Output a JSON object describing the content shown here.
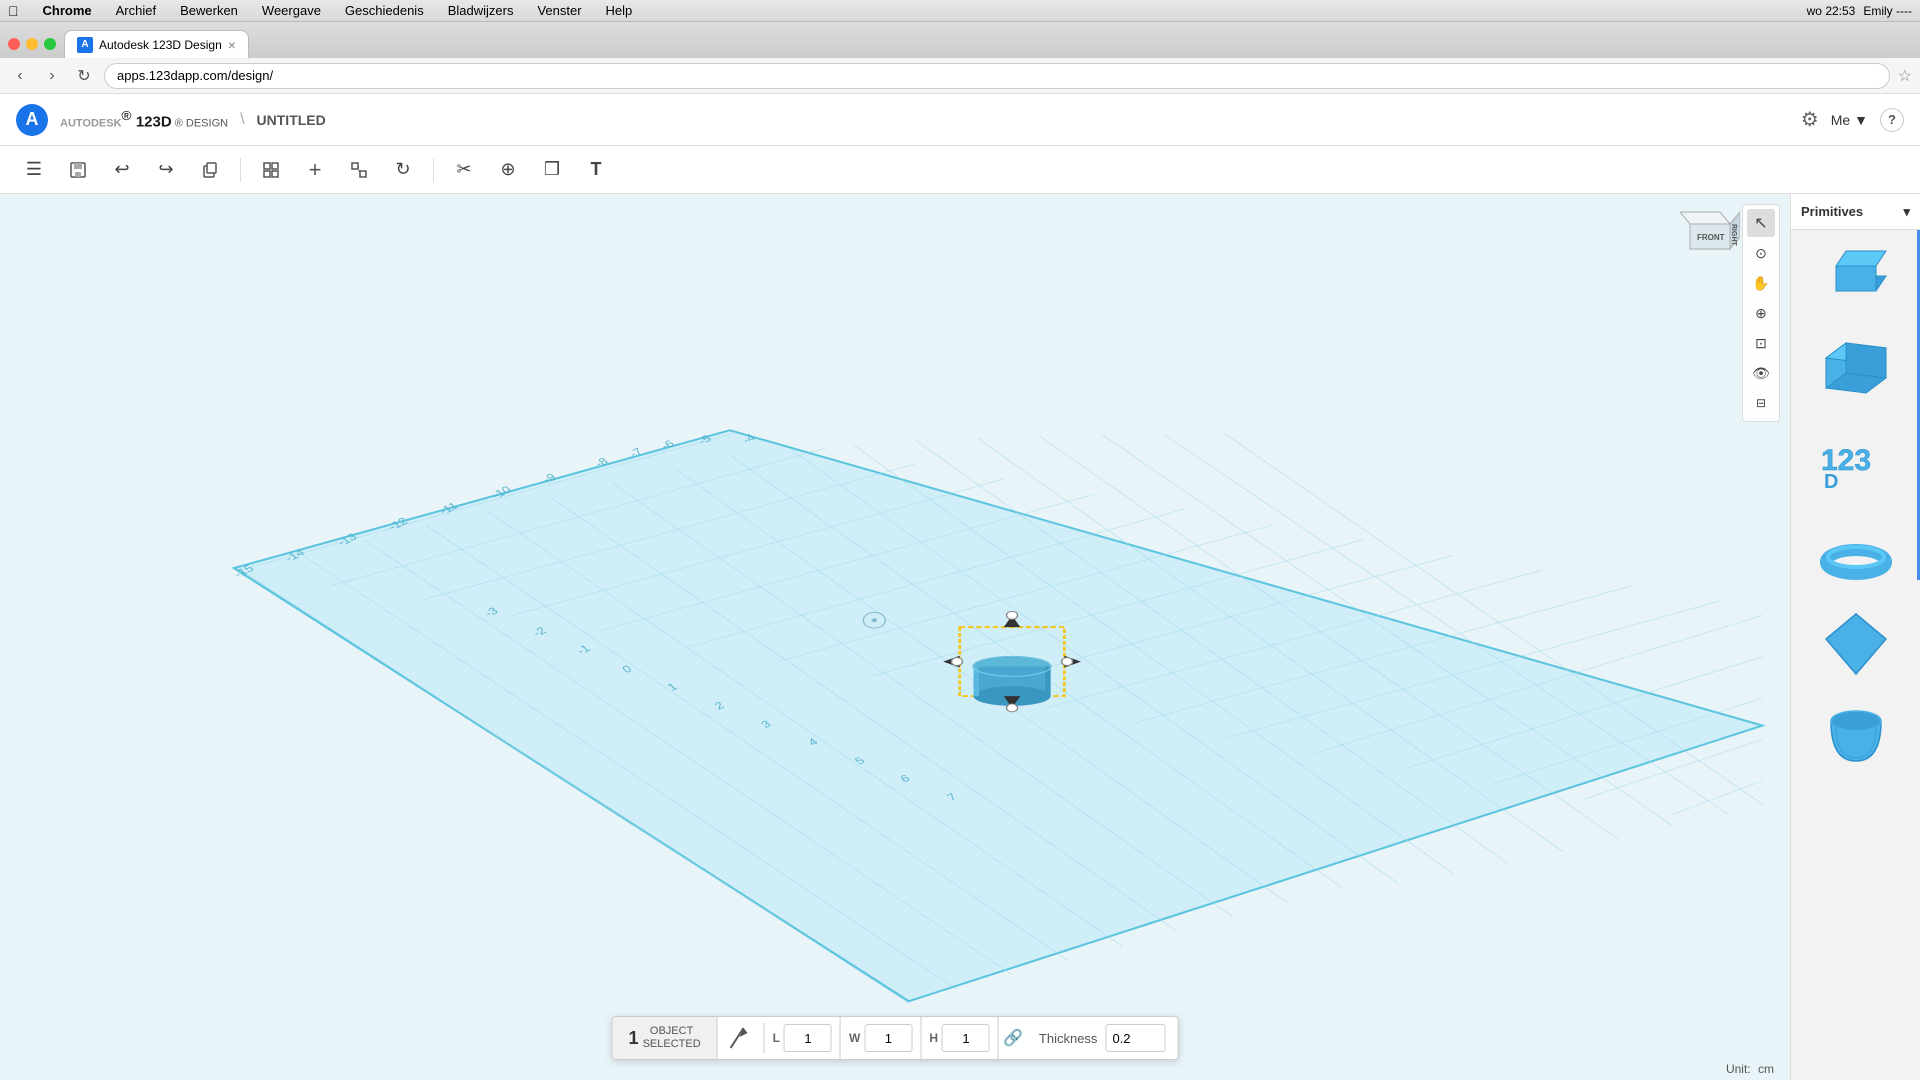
{
  "menubar": {
    "apple": "⌘",
    "app_name": "Chrome",
    "items": [
      "Archief",
      "Bewerken",
      "Weergave",
      "Geschiedenis",
      "Bladwijzers",
      "Venster",
      "Help"
    ],
    "right": {
      "time": "wo 22:53",
      "user": "Emily ----",
      "battery": "⌫",
      "wifi": "◈"
    }
  },
  "browser": {
    "tab_label": "Autodesk 123D Design",
    "url": "apps.123dapp.com/design/"
  },
  "app": {
    "logo": "A",
    "brand_top": "AUTODESK",
    "brand_exp": "®",
    "brand_name": "123D",
    "app_name": "DESIGN",
    "separator": "\\",
    "project": "UNTITLED",
    "me_label": "Me",
    "help": "?"
  },
  "toolbar": {
    "buttons": [
      {
        "name": "menu-btn",
        "icon": "☰"
      },
      {
        "name": "save-btn",
        "icon": "💾"
      },
      {
        "name": "undo-btn",
        "icon": "↩"
      },
      {
        "name": "redo-btn",
        "icon": "↪"
      },
      {
        "name": "copy-btn",
        "icon": "⬜"
      },
      {
        "name": "sep1",
        "icon": ""
      },
      {
        "name": "grid-btn",
        "icon": "⊞"
      },
      {
        "name": "add-btn",
        "icon": "➕"
      },
      {
        "name": "snap-btn",
        "icon": "⊠"
      },
      {
        "name": "refresh-btn",
        "icon": "↻"
      },
      {
        "name": "sep2",
        "icon": ""
      },
      {
        "name": "scissors-btn",
        "icon": "✂"
      },
      {
        "name": "transform-btn",
        "icon": "⊕"
      },
      {
        "name": "layers-btn",
        "icon": "❒"
      },
      {
        "name": "text-btn",
        "icon": "T"
      }
    ]
  },
  "view_tools": {
    "buttons": [
      {
        "name": "select-tool",
        "icon": "↖",
        "active": true
      },
      {
        "name": "orbit-tool",
        "icon": "◉"
      },
      {
        "name": "pan-tool",
        "icon": "✋"
      },
      {
        "name": "zoom-tool",
        "icon": "🔍"
      },
      {
        "name": "fit-tool",
        "icon": "⊡"
      },
      {
        "name": "look-tool",
        "icon": "👁"
      },
      {
        "name": "camera-tool",
        "icon": "⊟"
      }
    ]
  },
  "primitives_panel": {
    "title": "Primitives",
    "chevron": "▾",
    "shapes": [
      {
        "name": "Box",
        "color": "#4aa8d8"
      },
      {
        "name": "Cylinder",
        "color": "#4aa8d8"
      },
      {
        "name": "Text3D",
        "color": "#4aa8d8"
      },
      {
        "name": "Torus",
        "color": "#4aa8d8"
      },
      {
        "name": "Diamond",
        "color": "#4aa8d8"
      },
      {
        "name": "Bucket",
        "color": "#4aa8d8"
      }
    ]
  },
  "nav_cube": {
    "front_label": "FRONT",
    "right_label": "RIGHT"
  },
  "bottom_panel": {
    "selected_count": "1",
    "selected_label_line1": "OBJECT",
    "selected_label_line2": "SELECTED",
    "l_label": "L",
    "l_value": "1",
    "w_label": "W",
    "w_value": "1",
    "h_label": "H",
    "h_value": "1",
    "thickness_label": "Thickness",
    "thickness_value": "0.2"
  },
  "status": {
    "unit_label": "Unit:",
    "unit_value": "cm"
  },
  "ruler": {
    "ticks": [
      "-15",
      "-14",
      "-13",
      "-12",
      "-11",
      "-10",
      "-9",
      "-8",
      "-7",
      "-6",
      "-5",
      "-4",
      "-3",
      "-2",
      "-1",
      "0",
      "1",
      "2",
      "3",
      "4",
      "5",
      "6",
      "7"
    ]
  }
}
